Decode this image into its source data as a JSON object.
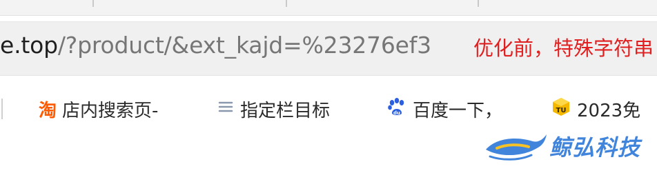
{
  "address_bar": {
    "url_host": "e.top",
    "url_path": "/?product/&ext_kajd=%23276ef3"
  },
  "annotation": {
    "text": "优化前，特殊字符串",
    "color": "#e02020"
  },
  "bookmarks": [
    {
      "label": "店内搜索页-",
      "icon": "taobao-icon"
    },
    {
      "label": "指定栏目标",
      "icon": "list-icon"
    },
    {
      "label": "百度一下，",
      "icon": "baidu-paw-icon"
    },
    {
      "label": "2023免",
      "icon": "tu-icon"
    }
  ],
  "watermark": {
    "text": "鲸弘科技",
    "color": "#1f6fd6"
  }
}
